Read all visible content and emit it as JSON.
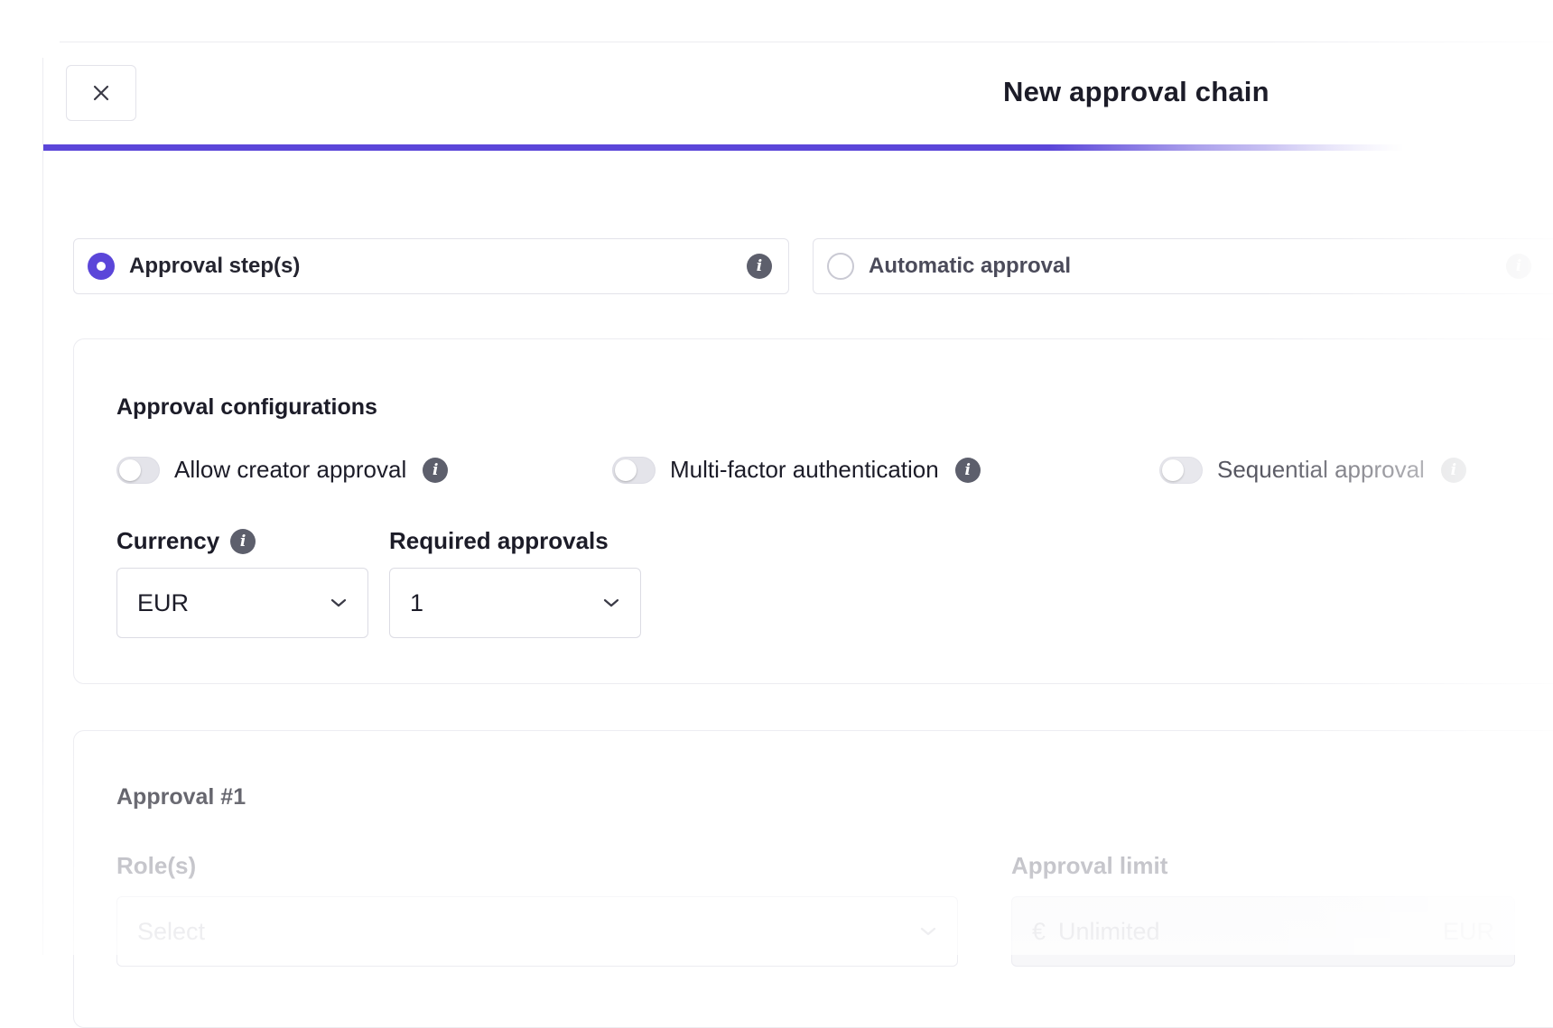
{
  "header": {
    "title": "New approval chain",
    "close_icon": "close-icon",
    "progress_percent": 90,
    "accent_color": "#5b46d9"
  },
  "mode": {
    "options": [
      {
        "label": "Approval step(s)",
        "selected": true,
        "icon": "info-icon"
      },
      {
        "label": "Automatic approval",
        "selected": false,
        "icon": "info-icon"
      }
    ]
  },
  "configurations": {
    "title": "Approval configurations",
    "toggles": [
      {
        "label": "Allow creator approval",
        "on": false
      },
      {
        "label": "Multi-factor authentication",
        "on": false
      },
      {
        "label": "Sequential approval",
        "on": false
      }
    ],
    "currency": {
      "label": "Currency",
      "value": "EUR"
    },
    "required_approvals": {
      "label": "Required approvals",
      "value": "1"
    }
  },
  "approval_1": {
    "title": "Approval #1",
    "roles": {
      "label": "Role(s)",
      "placeholder": "Select"
    },
    "limit": {
      "label": "Approval limit",
      "currency_symbol": "€",
      "placeholder": "Unlimited",
      "unit": "EUR"
    }
  }
}
